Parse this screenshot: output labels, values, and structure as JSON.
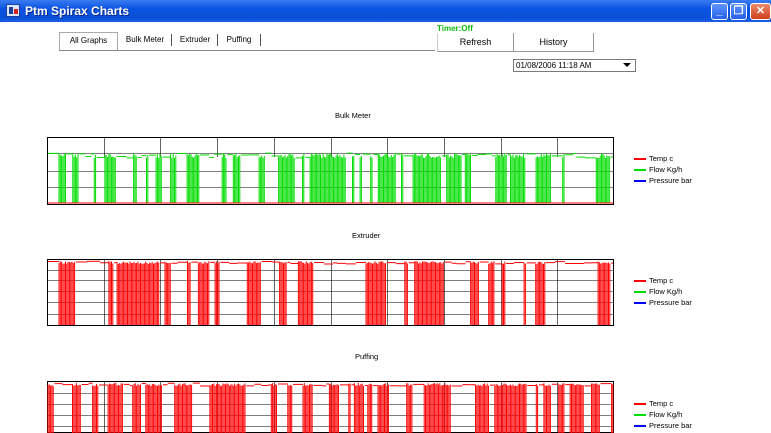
{
  "window": {
    "title": "Ptm Spirax Charts",
    "minimize_glyph": "_",
    "maximize_glyph": "❐",
    "close_glyph": "✕"
  },
  "tabs": [
    "All Graphs",
    "Bulk Meter",
    "Extruder",
    "Puffing"
  ],
  "timer_text": "Timer:Off",
  "buttons": {
    "refresh": "Refresh",
    "history": "History"
  },
  "date_selector": {
    "value": "01/08/2006 11:18 AM"
  },
  "colors": {
    "temp": "#ff0000",
    "flow": "#00dd00",
    "pressure": "#0000ff",
    "titlebar": "#0a54e3"
  },
  "legend": [
    "Temp c",
    "Flow Kg/h",
    "Pressure bar"
  ],
  "charts": [
    {
      "title": "Bulk Meter"
    },
    {
      "title": "Extruder"
    },
    {
      "title": "Puffing"
    }
  ]
}
